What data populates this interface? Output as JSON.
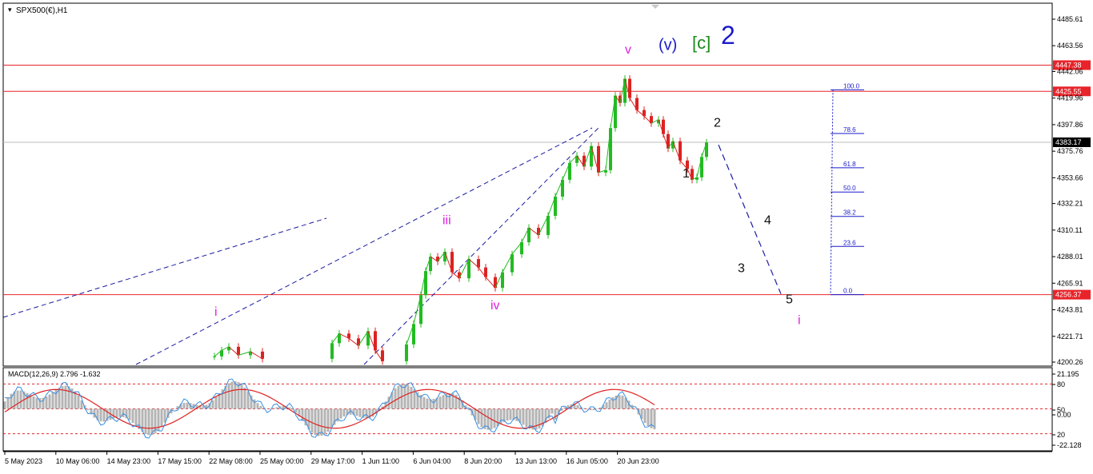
{
  "chart_data": [
    {
      "type": "line",
      "title": "SPX500(€),H1",
      "ylim": [
        4200.26,
        4485.61
      ],
      "y_ticks": [
        "4485.61",
        "4463.56",
        "4442.06",
        "4419.96",
        "4397.86",
        "4375.76",
        "4353.66",
        "4332.21",
        "4310.11",
        "4288.01",
        "4265.91",
        "4243.81",
        "4221.71",
        "4200.26"
      ],
      "x_ticks": [
        "5 May 2023",
        "10 May 06:00",
        "14 May 23:00",
        "17 May 15:00",
        "22 May 08:00",
        "25 May 00:00",
        "29 May 17:00",
        "1 Jun 11:00",
        "6 Jun 04:00",
        "8 Jun 20:00",
        "13 Jun 13:00",
        "16 Jun 05:00",
        "20 Jun 23:00"
      ],
      "current_price": "4383.17",
      "horizontal_levels": [
        {
          "label": "4447.38",
          "value": 4447.38,
          "color": "#e8242a"
        },
        {
          "label": "4425.55",
          "value": 4425.55,
          "color": "#e8242a"
        },
        {
          "label": "4256.37",
          "value": 4256.37,
          "color": "#e8242a"
        }
      ],
      "fibonacci_levels": [
        {
          "label": "100.0",
          "value": 4426.8
        },
        {
          "label": "78.6",
          "value": 4390.5
        },
        {
          "label": "61.8",
          "value": 4362.0
        },
        {
          "label": "50.0",
          "value": 4341.8
        },
        {
          "label": "38.2",
          "value": 4321.5
        },
        {
          "label": "23.6",
          "value": 4296.5
        },
        {
          "label": "0.0",
          "value": 4256.4
        }
      ],
      "wave_labels": [
        {
          "text": "i",
          "color": "#e020e0",
          "x": 8.0,
          "y": 4239.0
        },
        {
          "text": "iii",
          "color": "#e020e0",
          "x": 17.5,
          "y": 4315.0
        },
        {
          "text": "iv",
          "color": "#e020e0",
          "x": 19.5,
          "y": 4244.0
        },
        {
          "text": "v",
          "color": "#e020e0",
          "x": 25.1,
          "y": 4457.0
        },
        {
          "text": "(v)",
          "color": "#1a1acc",
          "x": 26.5,
          "y": 4460.0
        },
        {
          "text": "[c]",
          "color": "#1a8a1a",
          "x": 27.9,
          "y": 4461.0
        },
        {
          "text": "2",
          "color": "#1a1acc",
          "x": 29.1,
          "y": 4465.0
        },
        {
          "text": "1",
          "color": "#111111",
          "x": 27.5,
          "y": 4354.0
        },
        {
          "text": "2",
          "color": "#111111",
          "x": 28.8,
          "y": 4396.0
        },
        {
          "text": "3",
          "color": "#111111",
          "x": 29.8,
          "y": 4275.0
        },
        {
          "text": "4",
          "color": "#111111",
          "x": 30.9,
          "y": 4315.0
        },
        {
          "text": "5",
          "color": "#111111",
          "x": 31.8,
          "y": 4249.0
        },
        {
          "text": "i",
          "color": "#e020e0",
          "x": 32.3,
          "y": 4232.0
        }
      ],
      "projection": [
        {
          "x": 29.0,
          "y": 4381.0
        },
        {
          "x": 31.6,
          "y": 4257.0
        }
      ],
      "price_series": [
        {
          "x": 8.0,
          "y": 4205.0
        },
        {
          "x": 8.3,
          "y": 4210.0
        },
        {
          "x": 8.6,
          "y": 4213.0
        },
        {
          "x": 9.0,
          "y": 4206.0
        },
        {
          "x": 9.5,
          "y": 4209.0
        },
        {
          "x": 10.0,
          "y": 4203.0
        },
        {
          "x": 12.9,
          "y": 4216.0
        },
        {
          "x": 13.2,
          "y": 4224.0
        },
        {
          "x": 13.6,
          "y": 4220.0
        },
        {
          "x": 14.0,
          "y": 4214.0
        },
        {
          "x": 14.4,
          "y": 4226.0
        },
        {
          "x": 14.7,
          "y": 4210.0
        },
        {
          "x": 15.0,
          "y": 4201.0
        },
        {
          "x": 16.0,
          "y": 4215.0
        },
        {
          "x": 16.3,
          "y": 4232.0
        },
        {
          "x": 16.6,
          "y": 4256.0
        },
        {
          "x": 16.8,
          "y": 4276.0
        },
        {
          "x": 17.0,
          "y": 4288.0
        },
        {
          "x": 17.3,
          "y": 4284.0
        },
        {
          "x": 17.6,
          "y": 4292.0
        },
        {
          "x": 17.9,
          "y": 4275.0
        },
        {
          "x": 18.2,
          "y": 4270.0
        },
        {
          "x": 18.6,
          "y": 4286.0
        },
        {
          "x": 19.0,
          "y": 4279.0
        },
        {
          "x": 19.3,
          "y": 4271.0
        },
        {
          "x": 19.7,
          "y": 4262.0
        },
        {
          "x": 20.0,
          "y": 4275.0
        },
        {
          "x": 20.4,
          "y": 4290.0
        },
        {
          "x": 20.8,
          "y": 4300.0
        },
        {
          "x": 21.1,
          "y": 4312.0
        },
        {
          "x": 21.5,
          "y": 4306.0
        },
        {
          "x": 21.9,
          "y": 4322.0
        },
        {
          "x": 22.2,
          "y": 4338.0
        },
        {
          "x": 22.5,
          "y": 4352.0
        },
        {
          "x": 22.8,
          "y": 4366.0
        },
        {
          "x": 23.1,
          "y": 4372.0
        },
        {
          "x": 23.4,
          "y": 4363.0
        },
        {
          "x": 23.7,
          "y": 4380.0
        },
        {
          "x": 24.0,
          "y": 4358.0
        },
        {
          "x": 24.3,
          "y": 4360.0
        },
        {
          "x": 24.5,
          "y": 4395.0
        },
        {
          "x": 24.7,
          "y": 4422.0
        },
        {
          "x": 24.9,
          "y": 4416.0
        },
        {
          "x": 25.1,
          "y": 4436.0
        },
        {
          "x": 25.3,
          "y": 4420.0
        },
        {
          "x": 25.6,
          "y": 4410.0
        },
        {
          "x": 25.9,
          "y": 4405.0
        },
        {
          "x": 26.2,
          "y": 4399.0
        },
        {
          "x": 26.5,
          "y": 4402.0
        },
        {
          "x": 26.7,
          "y": 4390.0
        },
        {
          "x": 26.9,
          "y": 4378.0
        },
        {
          "x": 27.1,
          "y": 4384.0
        },
        {
          "x": 27.4,
          "y": 4368.0
        },
        {
          "x": 27.7,
          "y": 4361.0
        },
        {
          "x": 27.9,
          "y": 4352.0
        },
        {
          "x": 28.1,
          "y": 4354.0
        },
        {
          "x": 28.3,
          "y": 4371.0
        },
        {
          "x": 28.5,
          "y": 4383.0
        }
      ]
    },
    {
      "type": "line",
      "title": "MACD(12,26,9) 2.796 -1.632",
      "ylim": [
        -28,
        28
      ],
      "y_ticks": [
        "21.195",
        "80",
        "50",
        "0.00",
        "20",
        "-22.128"
      ],
      "signal_levels": [
        18.0,
        0.0,
        -18.0
      ]
    }
  ]
}
